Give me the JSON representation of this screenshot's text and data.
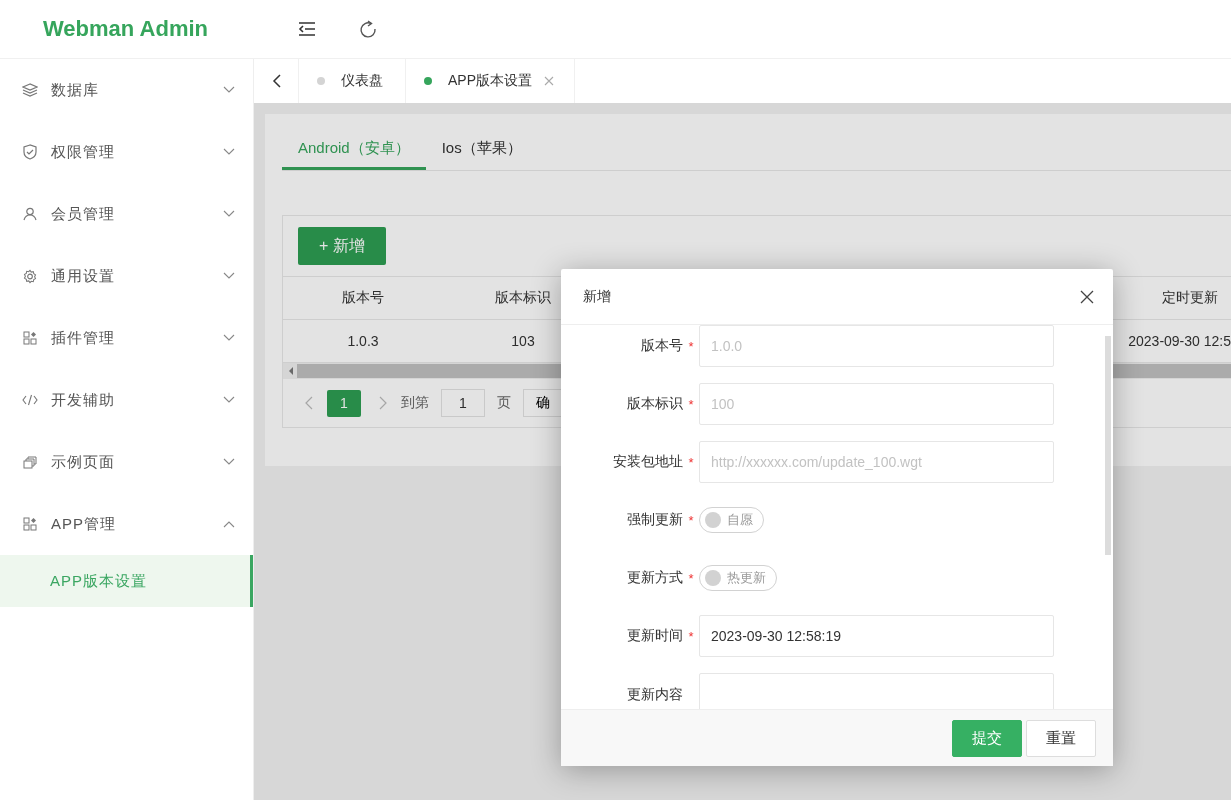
{
  "header": {
    "logo": "Webman Admin"
  },
  "sidebar": {
    "items": [
      {
        "label": "数据库",
        "expanded": false
      },
      {
        "label": "权限管理",
        "expanded": false
      },
      {
        "label": "会员管理",
        "expanded": false
      },
      {
        "label": "通用设置",
        "expanded": false
      },
      {
        "label": "插件管理",
        "expanded": false
      },
      {
        "label": "开发辅助",
        "expanded": false
      },
      {
        "label": "示例页面",
        "expanded": false
      },
      {
        "label": "APP管理",
        "expanded": true,
        "children": [
          {
            "label": "APP版本设置",
            "selected": true
          }
        ]
      }
    ]
  },
  "page_tabs": [
    {
      "label": "仪表盘",
      "selected": false
    },
    {
      "label": "APP版本设置",
      "selected": true
    }
  ],
  "platform_tabs": [
    {
      "label": "Android（安卓）",
      "selected": true
    },
    {
      "label": "Ios（苹果）",
      "selected": false
    }
  ],
  "add_button": "+ 新增",
  "table": {
    "columns": [
      "版本号",
      "版本标识",
      "定时更新"
    ],
    "rows": [
      [
        "1.0.3",
        "103",
        "2023-09-30 12:5"
      ]
    ]
  },
  "pagination": {
    "page": "1",
    "goto_label": "到第",
    "goto_value": "1",
    "page_label": "页",
    "confirm": "确"
  },
  "dialog": {
    "title": "新增",
    "fields": [
      {
        "kind": "input",
        "label": "版本号",
        "required_mark": "*",
        "placeholder": "1.0.0"
      },
      {
        "kind": "input",
        "label": "版本标识",
        "required_mark": "*",
        "placeholder": "100"
      },
      {
        "kind": "input",
        "label": "安装包地址",
        "required_mark": "*",
        "placeholder": "http://xxxxxx.com/update_100.wgt"
      },
      {
        "kind": "switch",
        "label": "强制更新",
        "required_mark": "*",
        "on": false,
        "text": "自愿"
      },
      {
        "kind": "switch",
        "label": "更新方式",
        "required_mark": "*",
        "on": false,
        "text": "热更新"
      },
      {
        "kind": "input",
        "label": "更新时间",
        "required_mark": "*",
        "value": "2023-09-30 12:58:19"
      },
      {
        "kind": "textarea",
        "label": "更新内容"
      }
    ],
    "buttons": [
      {
        "label": "提交",
        "kind": "primary"
      },
      {
        "label": "重置",
        "kind": "default"
      }
    ]
  }
}
